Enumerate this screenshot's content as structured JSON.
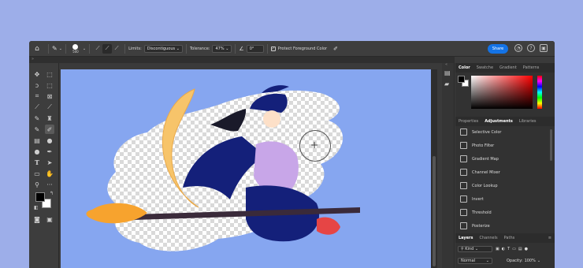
{
  "options_bar": {
    "brush_size": "500",
    "limits_label": "Limits:",
    "limits_value": "Discontiguous",
    "tolerance_label": "Tolerance:",
    "tolerance_value": "47%",
    "angle_value": "0°",
    "protect_label": "Protect Foreground Color",
    "protect_checked": true,
    "share_label": "Share"
  },
  "color_panel": {
    "tabs": [
      "Color",
      "Swatche",
      "Gradient",
      "Patterns"
    ],
    "active_tab": "Color"
  },
  "adjustments_panel": {
    "tabs": [
      "Properties",
      "Adjustments",
      "Libraries"
    ],
    "active_tab": "Adjustments",
    "items": [
      "Selective Color",
      "Photo Filter",
      "Gradient Map",
      "Channel Mixer",
      "Color Lookup",
      "Invert",
      "Threshold",
      "Posterize"
    ]
  },
  "layers_panel": {
    "tabs": [
      "Layers",
      "Channels",
      "Paths"
    ],
    "active_tab": "Layers",
    "filter_label": "Kind",
    "blend_mode": "Normal",
    "opacity_label": "Opacity:",
    "opacity_value": "100%"
  },
  "colors": {
    "foreground": "#000000",
    "background": "#ffffff",
    "canvas_bg": "#86a6f0",
    "accent": "#1473e6"
  }
}
